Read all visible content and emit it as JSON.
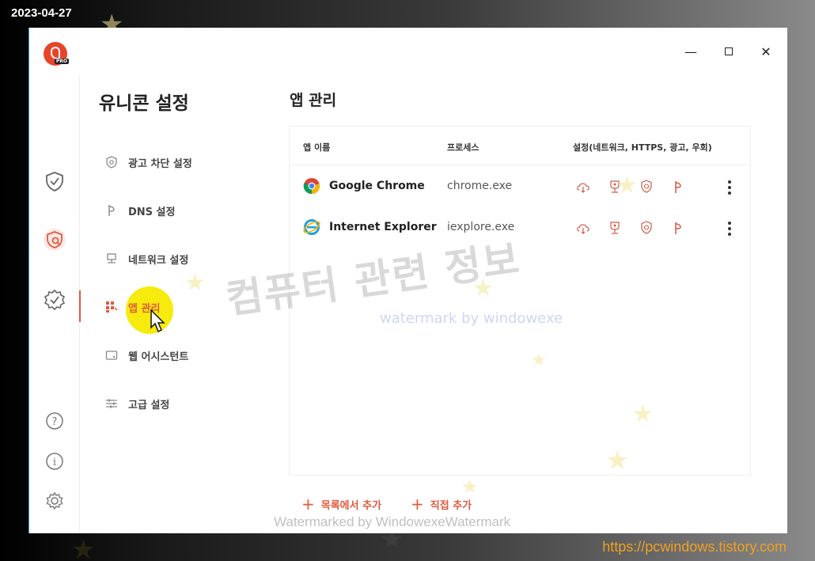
{
  "overlay": {
    "date": "2023-04-27",
    "site_url": "https://pcwindows.tistory.com"
  },
  "window": {
    "controls": {
      "minimize": "—",
      "close": "✕"
    }
  },
  "rail": {
    "icons": [
      "shield-check-icon",
      "shield-gear-icon",
      "badge-check-icon",
      "help-icon",
      "info-icon",
      "settings-icon"
    ],
    "active_index": 1
  },
  "nav": {
    "title": "유니콘 설정",
    "items": [
      {
        "label": "광고 차단 설정",
        "icon": "shield-icon"
      },
      {
        "label": "DNS 설정",
        "icon": "dns-icon"
      },
      {
        "label": "네트워크 설정",
        "icon": "network-icon"
      },
      {
        "label": "앱 관리",
        "icon": "app-grid-icon",
        "active": true
      },
      {
        "label": "웹 어시스턴트",
        "icon": "web-assistant-icon"
      },
      {
        "label": "고급 설정",
        "icon": "sliders-icon"
      }
    ]
  },
  "main": {
    "title": "앱 관리",
    "columns": [
      "앱 이름",
      "프로세스",
      "설정(네트워크, HTTPS, 광고, 우회)"
    ],
    "rows": [
      {
        "name": "Google Chrome",
        "process": "chrome.exe",
        "icon": "chrome-icon"
      },
      {
        "name": "Internet Explorer",
        "process": "iexplore.exe",
        "icon": "ie-icon"
      }
    ],
    "row_setting_icons": [
      "cloud-network-icon",
      "certificate-icon",
      "shield-ad-icon",
      "bypass-icon"
    ],
    "actions": {
      "add_from_list": "목록에서 추가",
      "add_direct": "직접 추가"
    }
  },
  "watermarks": {
    "korean": "컴퓨터 관련 정보",
    "english": "watermark by windowexe",
    "bottom": "Watermarked by WindowexeWatermark"
  },
  "colors": {
    "accent": "#e05a3e",
    "highlight": "#f5ea00"
  }
}
